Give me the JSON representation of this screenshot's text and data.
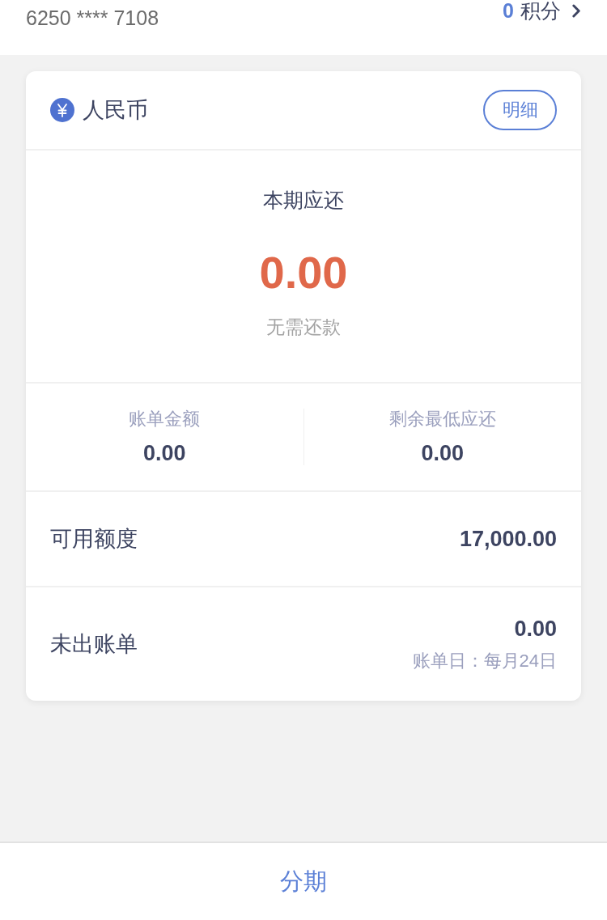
{
  "header": {
    "card_number": "6250 **** 7108",
    "points": {
      "value": "0",
      "unit": "积分"
    }
  },
  "account": {
    "currency": "人民币",
    "detail_button": "明细",
    "due": {
      "label": "本期应还",
      "amount": "0.00",
      "note": "无需还款"
    },
    "summary": [
      {
        "label": "账单金额",
        "value": "0.00"
      },
      {
        "label": "剩余最低应还",
        "value": "0.00"
      }
    ],
    "rows": [
      {
        "label": "可用额度",
        "value": "17,000.00"
      },
      {
        "label": "未出账单",
        "value": "0.00",
        "note": "账单日：每月24日"
      }
    ]
  },
  "bottom_bar": {
    "button": "分期"
  }
}
